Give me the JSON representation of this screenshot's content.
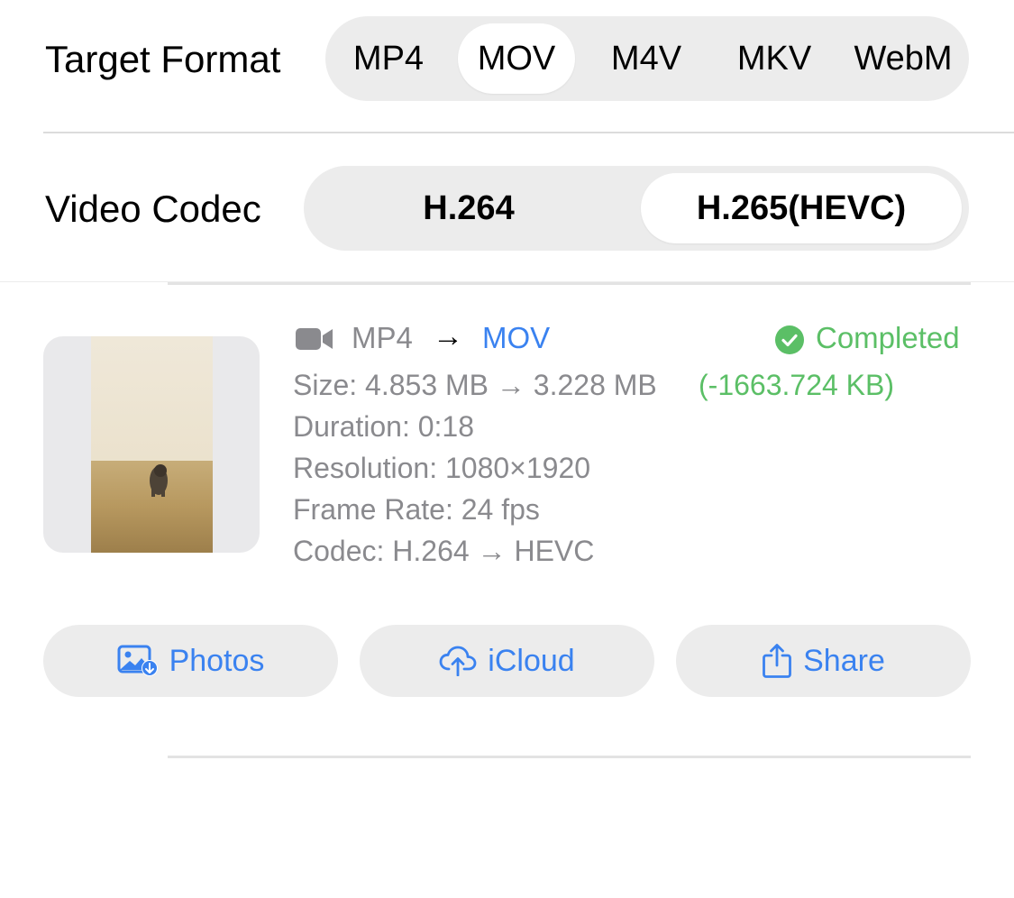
{
  "target_format": {
    "label": "Target Format",
    "options": [
      "MP4",
      "MOV",
      "M4V",
      "MKV",
      "WebM"
    ],
    "selected": "MOV"
  },
  "video_codec": {
    "label": "Video Codec",
    "options": [
      "H.264",
      "H.265(HEVC)"
    ],
    "selected": "H.265(HEVC)"
  },
  "item": {
    "icon": "video-camera-icon",
    "source_format": "MP4",
    "arrow": "→",
    "target_format": "MOV",
    "status": "Completed",
    "status_icon": "checkmark-circle-icon",
    "size_text": "Size: 4.853 MB → 3.228 MB",
    "size_delta": "(-1663.724 KB)",
    "duration": "Duration: 0:18",
    "resolution": "Resolution: 1080×1920",
    "frame_rate": "Frame Rate: 24 fps",
    "codec": "Codec: H.264 → HEVC"
  },
  "actions": {
    "photos": "Photos",
    "icloud": "iCloud",
    "share": "Share"
  },
  "colors": {
    "accent": "#3a82f0",
    "success": "#5bbf66",
    "secondary_text": "#8a8a8e",
    "segment_bg": "#ececec"
  }
}
